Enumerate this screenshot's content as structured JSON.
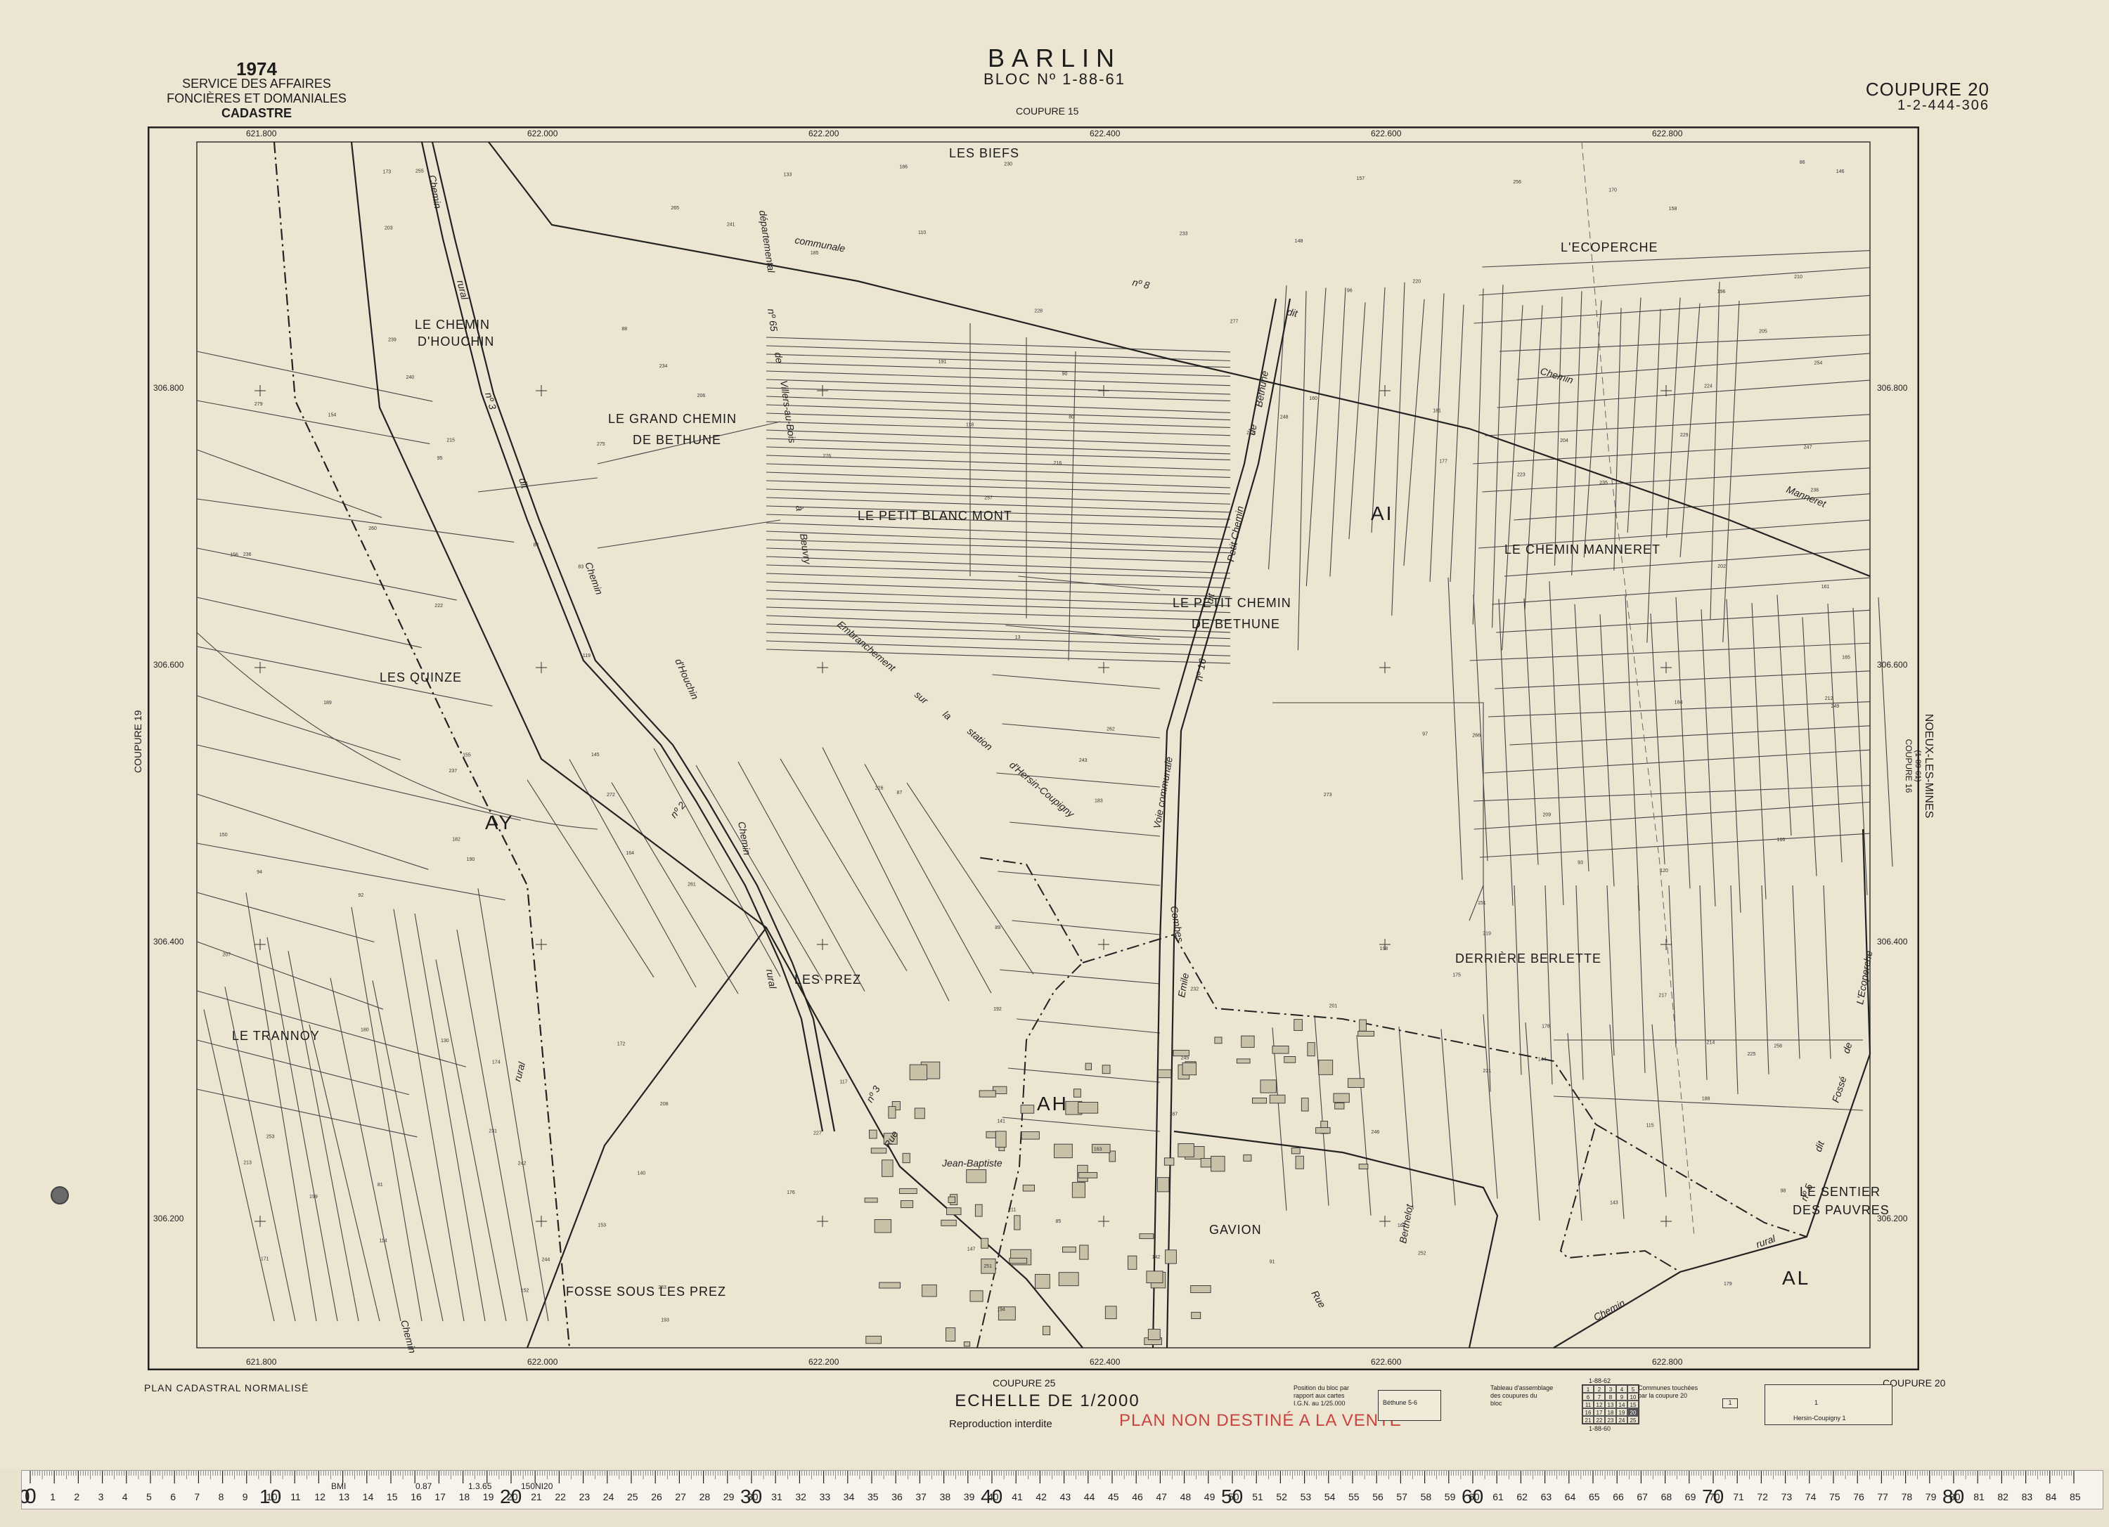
{
  "header": {
    "year": "1974",
    "service_line1": "SERVICE DES AFFAIRES",
    "service_line2": "FONCIÈRES ET DOMANIALES",
    "cadastre": "CADASTRE",
    "town": "BARLIN",
    "bloc": "BLOC Nº 1-88-61",
    "coupure": "COUPURE 20",
    "code": "1-2-444-306",
    "coupure_top": "COUPURE 15",
    "coupure_bottom": "COUPURE 25",
    "coupure_left": "COUPURE 19",
    "coupure_right_town": "NOEUX-LES-MINES",
    "coupure_right_bloc": "(1-89-61)",
    "coupure_right": "COUPURE 16",
    "coupure_bottom_right": "COUPURE 20"
  },
  "coordinates": {
    "x_top": [
      "621.800",
      "622.000",
      "622.200",
      "622.400",
      "622.600",
      "622.800"
    ],
    "x_bottom": [
      "621.800",
      "622.000",
      "622.200",
      "622.400",
      "622.600",
      "622.800"
    ],
    "y_left": [
      "306.800",
      "306.600",
      "306.400",
      "306.200"
    ],
    "y_right": [
      "306.800",
      "306.600",
      "306.400",
      "306.200"
    ]
  },
  "places": {
    "les_biefs": "LES BIEFS",
    "l_ecoperche": "L'ECOPERCHE",
    "chemin_houchin_1": "LE CHEMIN",
    "chemin_houchin_2": "D'HOUCHIN",
    "grand_chemin_1": "LE GRAND CHEMIN",
    "grand_chemin_2": "DE BETHUNE",
    "petit_blanc_mont": "LE PETIT BLANC MONT",
    "chemin_manneret": "LE CHEMIN MANNERET",
    "petit_chemin_1": "LE PETIT CHEMIN",
    "petit_chemin_2": "DE BETHUNE",
    "les_quinze": "LES QUINZE",
    "les_prez": "LES PREZ",
    "derriere_berlette": "DERRIÈRE BERLETTE",
    "le_trannoy": "LE TRANNOY",
    "gavion": "GAVION",
    "sentier_1": "LE SENTIER",
    "sentier_2": "DES PAUVRES",
    "fosse": "FOSSE SOUS LES PREZ"
  },
  "sections": {
    "ai": "AI",
    "ay": "AY",
    "ah": "AH",
    "al": "AL"
  },
  "roads": {
    "communale": "communale",
    "n8": "nº 8",
    "dit_top": "dit",
    "chemin_ne": "Chemin",
    "manneret": "Manneret",
    "chemin_houchin_v": "Chemin",
    "rural": "rural",
    "n3": "nº 3",
    "dit_left": "dit",
    "chemin_v2": "Chemin",
    "dhouchin": "d'Houchin",
    "n2": "nº 2",
    "chemin_prez": "Chemin",
    "rural_prez": "rural",
    "rural_sw": "rural",
    "chemin_sw": "Chemin",
    "departemental": "départemental",
    "n65": "nº 65",
    "de": "de",
    "villers": "Villers-au-Bois",
    "a": "à",
    "beuvry": "Beuvry",
    "embranchement": "Embranchement",
    "sur": "sur",
    "la": "la",
    "station": "station",
    "hersin": "d'Hersin-Coupigny",
    "voie_communale": "Voie communale",
    "n16": "nº 16",
    "dit_center": "dit",
    "petit_chemin": "Petit Chemin",
    "de_c": "de",
    "bethune": "Bethune",
    "combes": "Combes",
    "emile": "Emile",
    "rue": "Rue",
    "jean_baptiste": "Jean-Baptiste",
    "n3b": "nº 3",
    "berthelot": "Berthelot",
    "rue_b": "Rue",
    "chemin_se": "Chemin",
    "rural_se": "rural",
    "n5": "nº 5",
    "dit_se": "dit",
    "fosse_de": "Fossé",
    "de_se": "de",
    "lecoperche": "L'Ecoperche"
  },
  "parcels": [
    "13",
    "251",
    "252",
    "253",
    "254",
    "255",
    "256",
    "257",
    "258",
    "260",
    "261",
    "262",
    "265",
    "266",
    "272",
    "273",
    "275",
    "276",
    "277",
    "279",
    "283",
    "191",
    "192",
    "193",
    "194",
    "196",
    "198",
    "199",
    "201",
    "202",
    "80",
    "81",
    "83",
    "84",
    "85",
    "86",
    "87",
    "88",
    "89",
    "90",
    "91",
    "92",
    "93",
    "94",
    "95",
    "96",
    "97",
    "98",
    "110",
    "114",
    "115",
    "117",
    "118",
    "119",
    "120",
    "130",
    "133",
    "140",
    "141",
    "142",
    "143",
    "144",
    "145",
    "146",
    "147",
    "148",
    "150",
    "151",
    "152",
    "153",
    "154",
    "155",
    "156",
    "157",
    "158",
    "160",
    "161",
    "162",
    "163",
    "164",
    "165",
    "166",
    "170",
    "171",
    "172",
    "173",
    "174",
    "175",
    "176",
    "177",
    "178",
    "179",
    "180",
    "181",
    "182",
    "183",
    "184",
    "185",
    "186",
    "187",
    "188",
    "189",
    "190",
    "203",
    "204",
    "205",
    "206",
    "207",
    "208",
    "209",
    "210",
    "211",
    "212",
    "213",
    "214",
    "215",
    "216",
    "217",
    "218",
    "219",
    "220",
    "221",
    "222",
    "223",
    "224",
    "225",
    "226",
    "227",
    "228",
    "229",
    "230",
    "231",
    "232",
    "233",
    "234",
    "235",
    "236",
    "237",
    "238",
    "239",
    "240",
    "241",
    "242",
    "243",
    "244",
    "245",
    "246",
    "247",
    "248",
    "249"
  ],
  "footer": {
    "plan": "PLAN CADASTRAL NORMALISÉ",
    "echelle": "ECHELLE DE 1/2000",
    "repro": "Reproduction interdite",
    "red": "PLAN NON DESTINÉ A LA VENTE",
    "position_1": "Position du bloc par",
    "position_2": "rapport aux cartes",
    "position_3": "I.G.N. au 1/25.000",
    "ign_box": "Béthune 5-6",
    "tableau_1": "Tableau d'assemblage",
    "tableau_2": "des coupures du",
    "tableau_3": "bloc",
    "grid_top": "1-88-62",
    "grid_bottom": "1-88-60",
    "grid_cells": [
      "1",
      "2",
      "3",
      "4",
      "5",
      "6",
      "7",
      "8",
      "9",
      "10",
      "11",
      "12",
      "13",
      "14",
      "15",
      "16",
      "17",
      "18",
      "19",
      "20",
      "21",
      "22",
      "23",
      "24",
      "25"
    ],
    "communes_1": "Communes touchées",
    "communes_2": "par la coupure 20",
    "commune_box": "Hersin-Coupigny 1",
    "small_box": "1"
  },
  "ruler": {
    "left_label": "0",
    "numbers": [
      "1",
      "2",
      "3",
      "4",
      "5",
      "6",
      "7",
      "8",
      "9",
      "10",
      "11",
      "12",
      "13",
      "14",
      "15",
      "16",
      "17",
      "18",
      "19",
      "20",
      "21",
      "22",
      "23",
      "24",
      "25",
      "26",
      "27",
      "28",
      "29",
      "30",
      "31",
      "32",
      "33",
      "34",
      "35",
      "36",
      "37",
      "38",
      "39",
      "40",
      "41",
      "42",
      "43",
      "44",
      "45",
      "46",
      "47",
      "48",
      "49",
      "50",
      "51",
      "52",
      "53",
      "54",
      "55",
      "56",
      "57",
      "58",
      "59",
      "60",
      "61",
      "62",
      "63",
      "64",
      "65",
      "66",
      "67",
      "68",
      "69",
      "70",
      "71",
      "72",
      "73",
      "74",
      "75",
      "76",
      "77",
      "78",
      "79",
      "80",
      "81",
      "82",
      "83",
      "84",
      "85"
    ],
    "big_marks": [
      "0",
      "10",
      "20",
      "30",
      "40",
      "50",
      "60",
      "70",
      "80"
    ],
    "brand": "BMI",
    "codes": [
      "0.87",
      "1.3.65",
      "150NI20"
    ]
  }
}
